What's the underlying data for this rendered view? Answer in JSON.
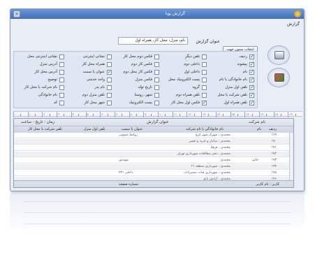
{
  "window": {
    "title": "گزارش پویا",
    "close_glyph": "×"
  },
  "group_label": "گزارش",
  "report_title": {
    "label": "عنوان گزارش",
    "value": "نام، منزل، محل کار، همراه اول"
  },
  "select_columns_button": "انتخاب ستون جهت چاپ",
  "checkboxes": [
    {
      "label": "ردیف",
      "checked": true
    },
    {
      "label": "پیشوند",
      "checked": true
    },
    {
      "label": "نام",
      "checked": true
    },
    {
      "label": "نام خانوادگی یا نام",
      "checked": true
    },
    {
      "label": "تلفن اول منزل",
      "checked": true
    },
    {
      "label": "تلفن شرکت یا محل",
      "checked": true
    },
    {
      "label": "تلفن همراه اول",
      "checked": true
    },
    {
      "label": "تلفن دیگر",
      "checked": false
    },
    {
      "label": "داخلی دوم",
      "checked": false
    },
    {
      "label": "داخلی اول",
      "checked": false
    },
    {
      "label": "پست الکترونیک محل",
      "checked": false
    },
    {
      "label": "گروه",
      "checked": false
    },
    {
      "label": "تلفن همراه دوم",
      "checked": false
    },
    {
      "label": "فکس اول محل کار",
      "checked": true
    },
    {
      "label": "فکس دوم محل کار",
      "checked": false
    },
    {
      "label": "فکس کار دوم",
      "checked": false
    },
    {
      "label": "فکس کار محل دوم",
      "checked": false
    },
    {
      "label": "فکس منزل",
      "checked": false
    },
    {
      "label": "تاریخ تولد",
      "checked": false
    },
    {
      "label": "شهر، روستا",
      "checked": false
    },
    {
      "label": "پست الکترونیک",
      "checked": false
    },
    {
      "label": "نشانی اینترنتی",
      "checked": false
    },
    {
      "label": "همراه محل کار",
      "checked": false
    },
    {
      "label": "عنوان یا سمت",
      "checked": true
    },
    {
      "label": "واحد خدمتی",
      "checked": false
    },
    {
      "label": "نام پدر",
      "checked": false
    },
    {
      "label": "تلفن منزل دوم",
      "checked": false
    },
    {
      "label": "شهر محل کار",
      "checked": false
    },
    {
      "label": "نشانی اینترنتی محل",
      "checked": false
    },
    {
      "label": "آدرس منزل",
      "checked": false
    },
    {
      "label": "آدرس محل کار",
      "checked": false
    },
    {
      "label": "توضیح",
      "checked": false
    },
    {
      "label": "نام شرکت یا محل کار",
      "checked": false
    },
    {
      "label": "نام خانوادگی",
      "checked": false
    },
    {
      "label": "کد",
      "checked": false
    }
  ],
  "icons": {
    "print": "printer-icon",
    "export": "export-icon"
  },
  "ruler_ticks": [
    "۰",
    "۱",
    "۲",
    "۳",
    "۴",
    "۵",
    "۶",
    "۷",
    "۸",
    "۹",
    "۱۰",
    "۱۱",
    "۱۲",
    "۱۳",
    "۱۴",
    "۱۵",
    "۱۶",
    "۱۷",
    "۱۸",
    "۱۹"
  ],
  "report": {
    "header_left": "زمان : تاریخ - ساعت",
    "header_center": "عنوان گزارش",
    "header_right": "نام شرکت",
    "columns": [
      "ردیف",
      "نام",
      "نام خانوادگی یا نام شرکت",
      "عنوان یا سمت",
      "تلفن اول منزل",
      "تلفن شرکت یا محل کار"
    ],
    "rows": [
      {
        "num": "۱۶۹",
        "name": "",
        "family": "محمدی ، شهرک شهر کرج",
        "title": "روابط عمومی",
        "home": "",
        "work": ""
      },
      {
        "num": "۱۷۰",
        "name": "",
        "family": "محمدی ، ساتیار و خرید و تعمیر",
        "title": "",
        "home": "",
        "work": ""
      },
      {
        "num": "۱۷۱",
        "name": "",
        "family": "محمدی ، فرهاد",
        "title": "",
        "home": "",
        "work": ""
      },
      {
        "num": "۱۷۲",
        "name": "",
        "family": "محمدی ، دفتر مطالعات شهرداری تهران",
        "title": "",
        "home": "",
        "work": ""
      },
      {
        "num": "۱۷۳",
        "name": "حاتم",
        "family": "محمدی",
        "title": "مهندس",
        "home": "",
        "work": ""
      },
      {
        "num": "۱۷۴",
        "name": "",
        "family": "محمدی ، شهرداری منطقه ۲۱",
        "title": "",
        "home": "",
        "work": ""
      },
      {
        "num": "۱۷۵",
        "name": "",
        "family": "محمدی ، شهرداری قنات شمیرانات",
        "title": "داخلی ۴۳۱",
        "home": "",
        "work": ""
      },
      {
        "num": "۱۷۶",
        "name": "",
        "family": "محمدی ، آرایش بانو",
        "title": "",
        "home": "",
        "work": ""
      }
    ],
    "footer_left": "شماره صفحه",
    "footer_right": "کاربر : نام کاربر"
  }
}
